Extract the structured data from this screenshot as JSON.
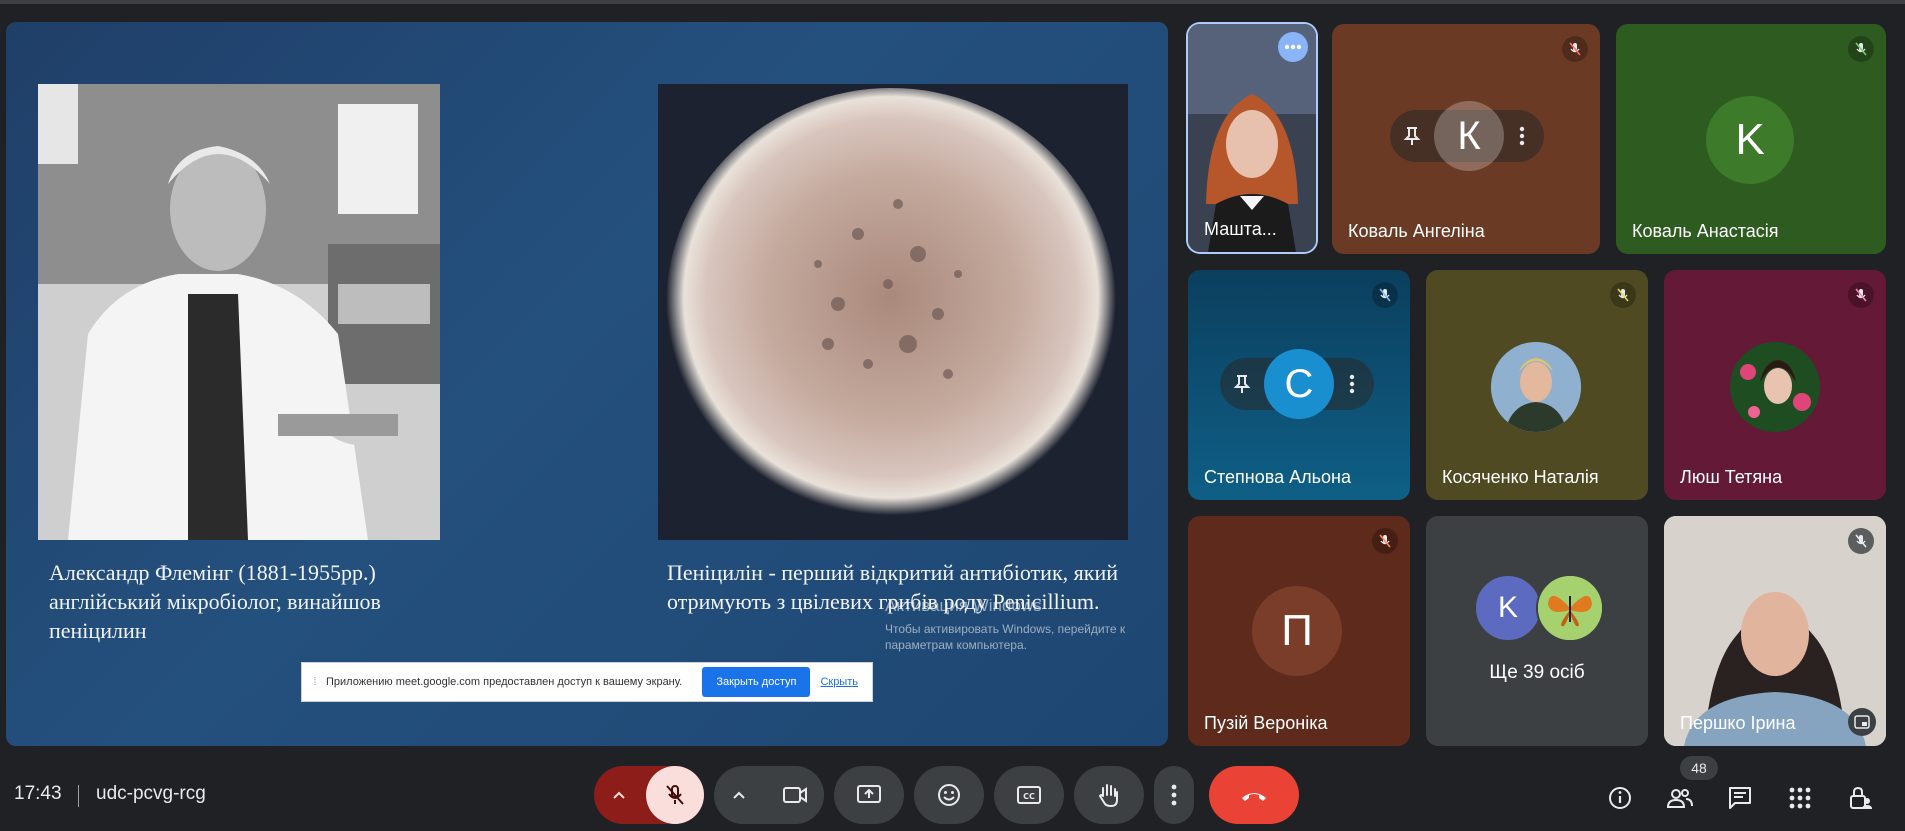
{
  "presentation": {
    "left_caption": "Александр Флемінг (1881-1955рр.) англійський мікробіолог, винайшов пеніцилин",
    "right_caption": "Пеніцилін - перший відкритий антибіотик, який отримують з цвілевих грибів роду Penicillium.",
    "watermark_title": "Активация Windows",
    "watermark_text": "Чтобы активировать Windows, перейдите к параметрам компьютера.",
    "share_notice": "Приложению meet.google.com предоставлен доступ к вашему экрану.",
    "stop_sharing_label": "Закрыть доступ",
    "hide_label": "Скрыть"
  },
  "participants": [
    {
      "name": "Машта...",
      "muted": false
    },
    {
      "name": "Коваль Ангеліна",
      "initial": "К",
      "muted": true
    },
    {
      "name": "Коваль Анастасія",
      "initial": "K",
      "muted": true
    },
    {
      "name": "Степнова Альона",
      "initial": "С",
      "muted": true
    },
    {
      "name": "Косяченко Наталія",
      "muted": true
    },
    {
      "name": "Люш Тетяна",
      "muted": true
    },
    {
      "name": "Пузій Вероніка",
      "initial": "П",
      "muted": true
    },
    {
      "name": "Ще 39 осіб",
      "initial": "K"
    },
    {
      "name": "Першко Ірина",
      "muted": true
    }
  ],
  "bottom_bar": {
    "time": "17:43",
    "meeting_code": "udc-pcvg-rcg",
    "people_count": "48"
  },
  "colors": {
    "end_call": "#ea4335",
    "mic_muted_bg": "#f9dedc",
    "mic_group_bg": "#8c1d18"
  }
}
